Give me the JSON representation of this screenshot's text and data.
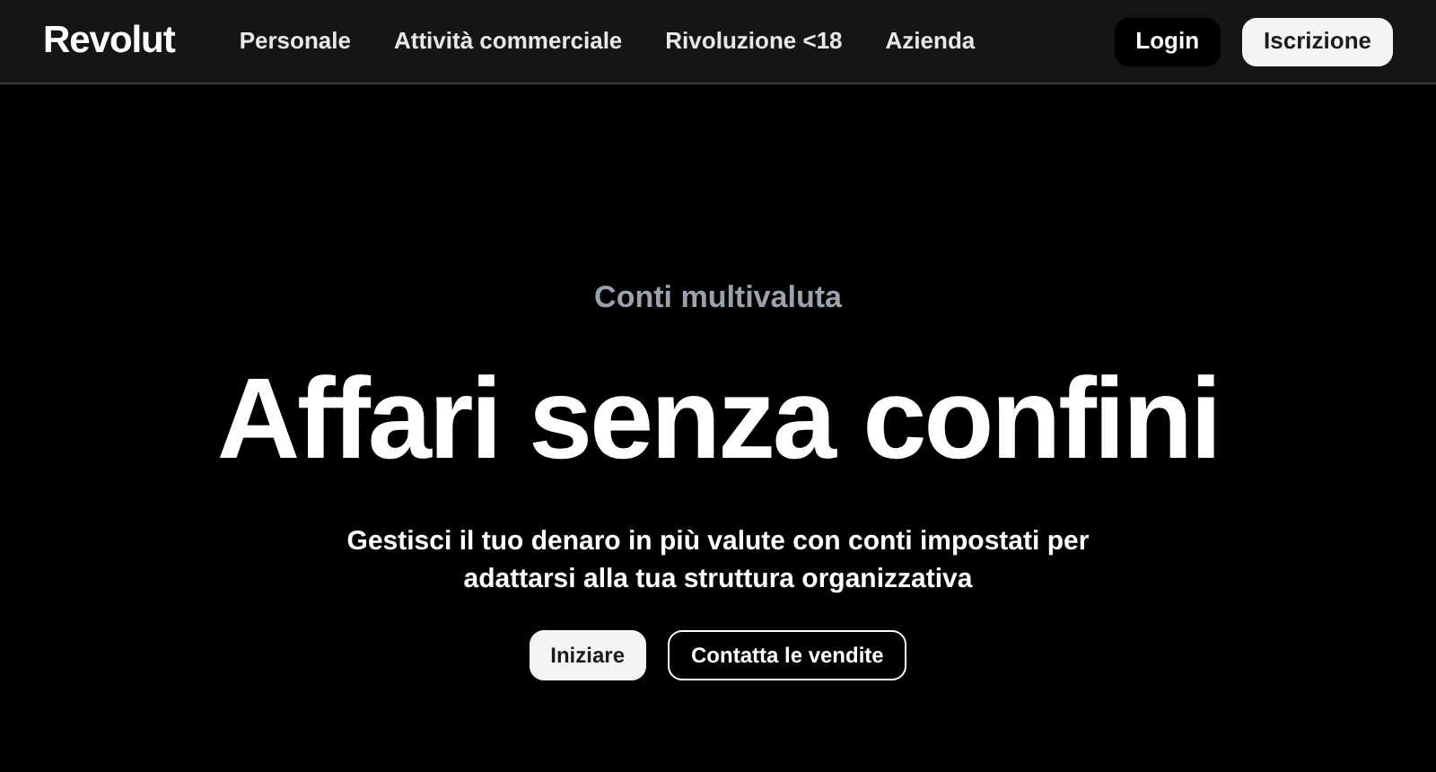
{
  "header": {
    "logo": "Revolut",
    "nav": [
      {
        "label": "Personale"
      },
      {
        "label": "Attività commerciale"
      },
      {
        "label": "Rivoluzione <18"
      },
      {
        "label": "Azienda"
      }
    ],
    "buttons": [
      {
        "label": "Login",
        "kind": "dark"
      },
      {
        "label": "Iscrizione",
        "kind": "light"
      }
    ]
  },
  "hero": {
    "eyebrow": "Conti multivaluta",
    "title": "Affari senza confini",
    "subtitle": "Gestisci il tuo denaro in più valute con conti impostati per adattarsi alla tua struttura organizzativa",
    "buttons": [
      {
        "label": "Iniziare",
        "kind": "filled"
      },
      {
        "label": "Contatta le vendite",
        "kind": "outline"
      }
    ]
  }
}
